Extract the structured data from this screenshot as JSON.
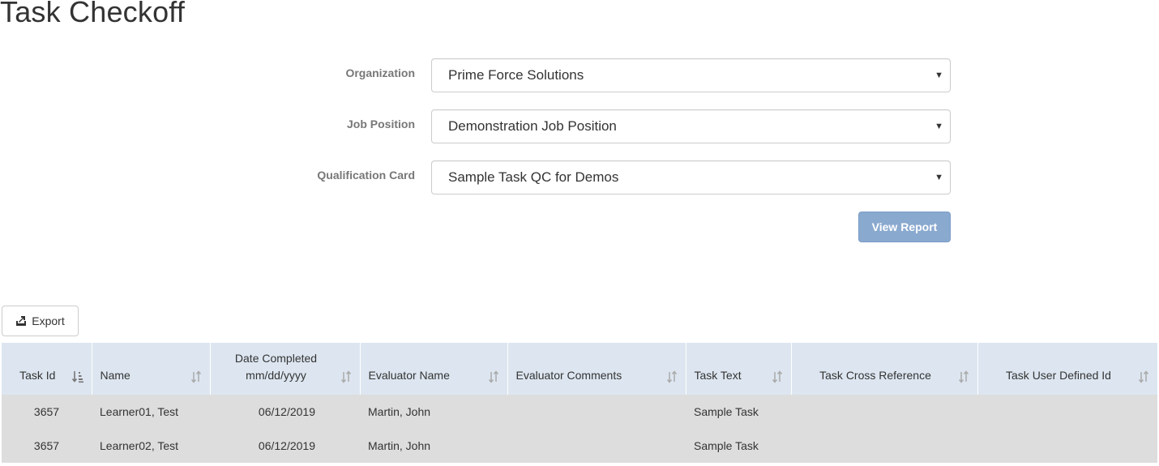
{
  "page": {
    "title": "Task Checkoff"
  },
  "form": {
    "organization": {
      "label": "Organization",
      "value": "Prime Force Solutions"
    },
    "job_position": {
      "label": "Job Position",
      "value": "Demonstration Job Position"
    },
    "qualification_card": {
      "label": "Qualification Card",
      "value": "Sample Task QC for Demos"
    },
    "view_report_label": "View Report"
  },
  "toolbar": {
    "export_label": "Export",
    "export_icon": "export-icon"
  },
  "table": {
    "columns": [
      {
        "label": "Task Id",
        "sort": "sorted-ascending"
      },
      {
        "label": "Name",
        "sort": "unsorted"
      },
      {
        "label": "Date Completed mm/dd/yyyy",
        "sort": "unsorted"
      },
      {
        "label": "Evaluator Name",
        "sort": "unsorted"
      },
      {
        "label": "Evaluator Comments",
        "sort": "unsorted"
      },
      {
        "label": "Task Text",
        "sort": "unsorted"
      },
      {
        "label": "Task Cross Reference",
        "sort": "unsorted"
      },
      {
        "label": "Task User Defined Id",
        "sort": "unsorted"
      }
    ],
    "rows": [
      [
        "3657",
        "Learner01, Test",
        "06/12/2019",
        "Martin, John",
        "",
        "Sample Task",
        "",
        ""
      ],
      [
        "3657",
        "Learner02, Test",
        "06/12/2019",
        "Martin, John",
        "",
        "Sample Task",
        "",
        ""
      ]
    ]
  },
  "colors": {
    "header_bg": "#dde6f0",
    "row_bg": "#dddddd",
    "primary_button": "#8aa9cf"
  }
}
